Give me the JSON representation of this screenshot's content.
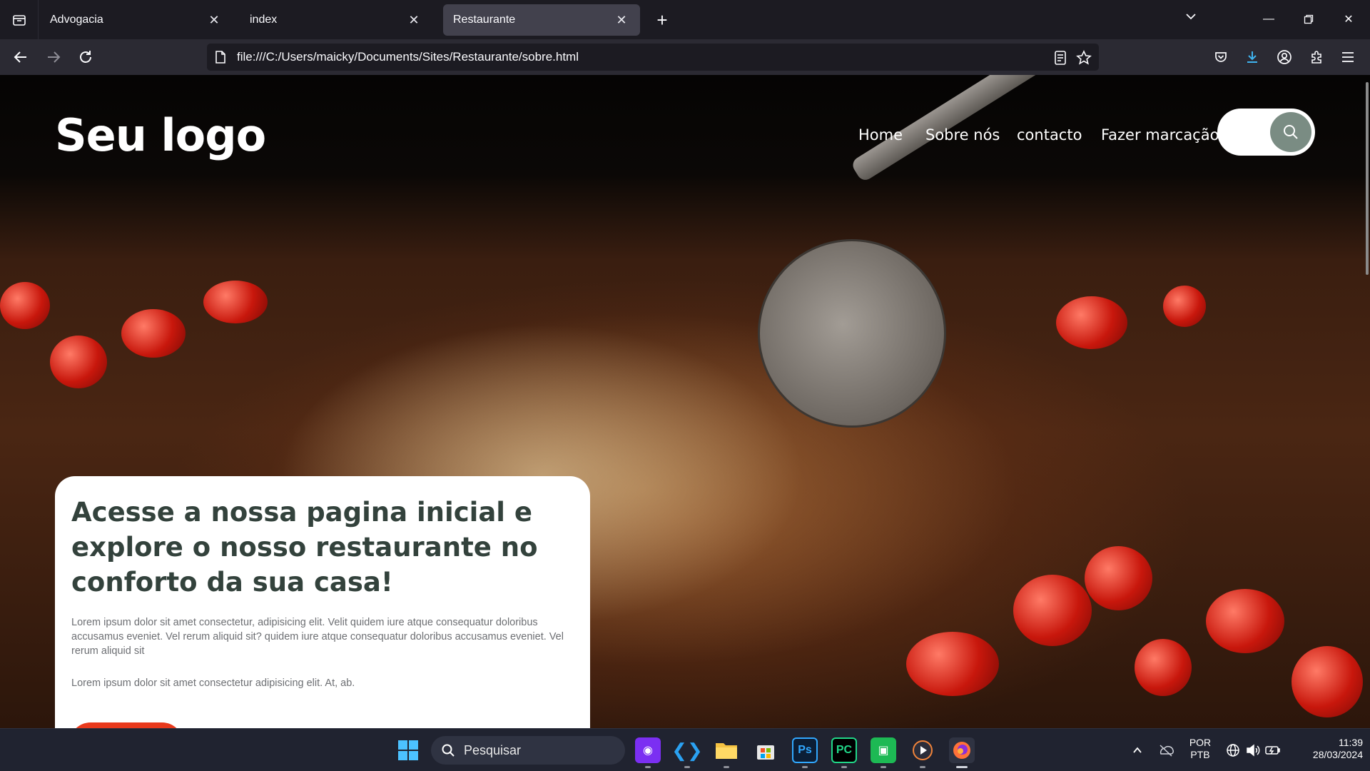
{
  "browser": {
    "tabs": [
      {
        "label": "Advogacia",
        "active": false
      },
      {
        "label": "index",
        "active": false
      },
      {
        "label": "Restaurante",
        "active": true
      }
    ],
    "url": "file:///C:/Users/maicky/Documents/Sites/Restaurante/sobre.html"
  },
  "site": {
    "logo": "Seu logo",
    "menu": [
      "Home",
      "Sobre nós",
      "contacto",
      "Fazer marcação"
    ],
    "card": {
      "heading": "Acesse a nossa pagina inicial e explore o nosso restaurante no conforto da sua casa!",
      "paragraph1": "Lorem ipsum dolor sit amet consectetur, adipisicing elit. Velit quidem iure atque consequatur doloribus accusamus eveniet. Vel rerum aliquid sit? quidem iure atque consequatur doloribus accusamus eveniet. Vel rerum aliquid sit",
      "paragraph2": "Lorem ipsum dolor sit amet consectetur adipisicing elit. At, ab."
    }
  },
  "taskbar": {
    "search_placeholder": "Pesquisar",
    "language": "POR",
    "layout": "PTB",
    "time": "11:39",
    "date": "28/03/2024"
  },
  "colors": {
    "accent_button": "#e8391c",
    "heading": "#33423c",
    "search_circle": "#7a8c83"
  }
}
